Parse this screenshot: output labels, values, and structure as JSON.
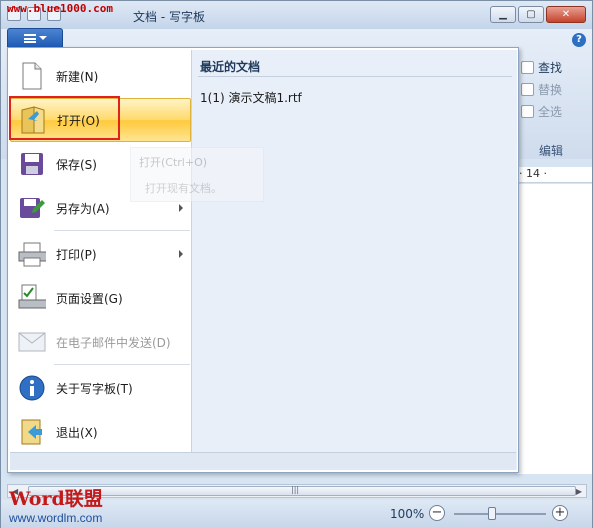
{
  "watermark_top": "www.blue1000.com",
  "window": {
    "title": "文档 - 写字板",
    "controls": [
      "minimize",
      "maximize",
      "close"
    ]
  },
  "ribbon": {
    "edit_items": [
      {
        "label": "查找",
        "icon": "find-icon",
        "enabled": true
      },
      {
        "label": "替换",
        "icon": "replace-icon",
        "enabled": false
      },
      {
        "label": "全选",
        "icon": "select-all-icon",
        "enabled": false
      }
    ],
    "edit_group_label": "编辑",
    "ruler_text": "· 14 ·"
  },
  "menu": {
    "items": [
      {
        "label": "新建(N)",
        "icon": "new-document-icon"
      },
      {
        "label": "打开(O)",
        "icon": "open-folder-icon"
      },
      {
        "label": "保存(S)",
        "icon": "save-icon"
      },
      {
        "label": "另存为(A)",
        "icon": "save-as-icon",
        "submenu": true
      },
      {
        "label": "打印(P)",
        "icon": "printer-icon",
        "submenu": true
      },
      {
        "label": "页面设置(G)",
        "icon": "page-setup-icon"
      },
      {
        "label": "在电子邮件中发送(D)",
        "icon": "email-icon",
        "disabled": true
      },
      {
        "label": "关于写字板(T)",
        "icon": "info-icon"
      },
      {
        "label": "退出(X)",
        "icon": "exit-icon"
      }
    ],
    "recent_header": "最近的文档",
    "recent_items": [
      {
        "number": "1(1)",
        "name": "演示文稿1.rtf"
      }
    ],
    "tooltip": {
      "title": "打开(Ctrl+O)",
      "description": "打开现有文档。"
    }
  },
  "status": {
    "zoom": "100%"
  },
  "watermark_bottom": {
    "word": "Word联盟",
    "url": "www.wordlm.com"
  },
  "colors": {
    "highlight": "#ffd96a",
    "red_box": "#e0211c",
    "accent": "#1f5bb5"
  }
}
